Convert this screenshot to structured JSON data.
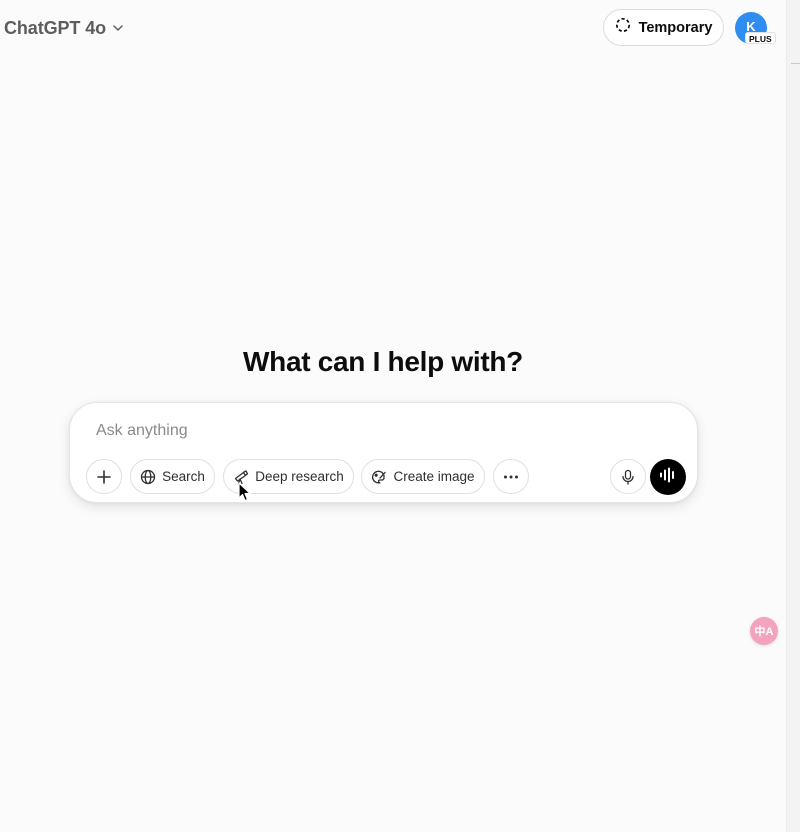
{
  "header": {
    "model_name": "ChatGPT 4o",
    "temporary_label": "Temporary",
    "avatar_initial": "K",
    "plan_badge": "PLUS"
  },
  "main": {
    "headline": "What can I help with?"
  },
  "composer": {
    "placeholder": "Ask anything",
    "value": "",
    "tools": {
      "search_label": "Search",
      "deep_research_label": "Deep research",
      "create_image_label": "Create image"
    }
  },
  "floating": {
    "translate_text": "中A"
  },
  "icons": {
    "model_menu": "chevron-down-icon",
    "temporary": "dashed-circle-icon",
    "add": "plus-icon",
    "search": "globe-icon",
    "deep_research": "telescope-icon",
    "create_image": "paint-palette-icon",
    "more": "ellipsis-icon",
    "dictate": "microphone-icon",
    "voice_mode": "waveform-icon",
    "translate": "translate-icon"
  },
  "colors": {
    "background": "#fbfbfb",
    "avatar": "#2f8cf0",
    "voice_button": "#000000",
    "translate_badge": "#f3a3bd"
  }
}
